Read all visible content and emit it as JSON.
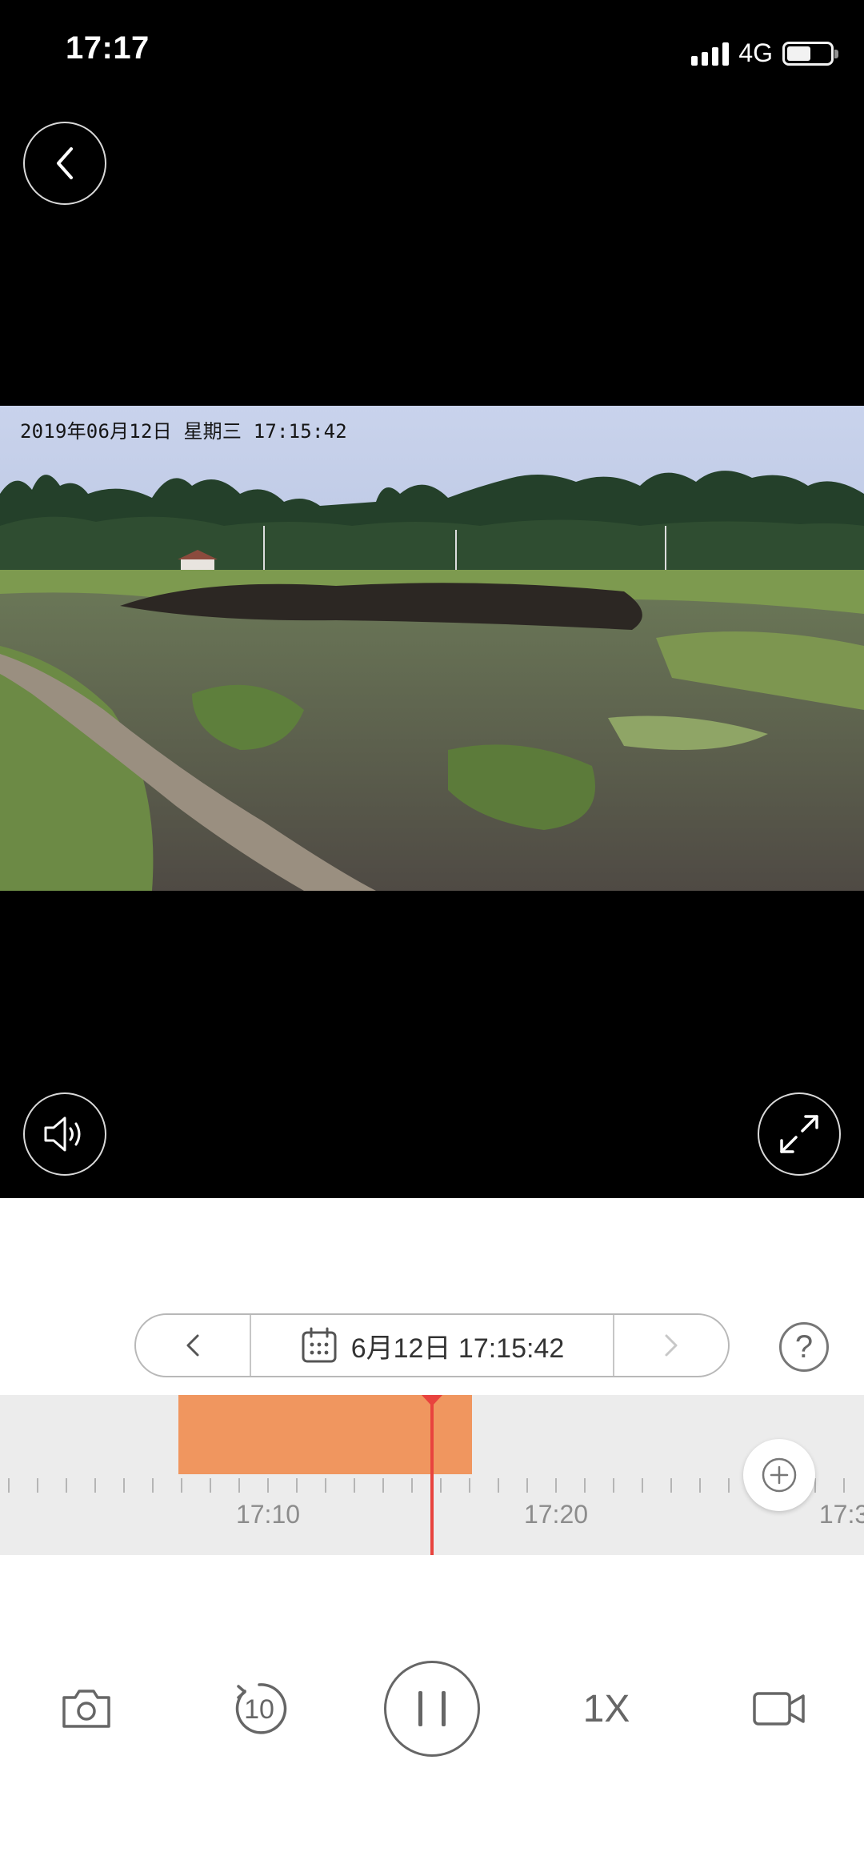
{
  "status_bar": {
    "time": "17:17",
    "network": "4G",
    "battery_level": 0.55
  },
  "player": {
    "back_icon": "chevron-left-icon",
    "osd_timestamp": "2019年06月12日  星期三  17:15:42",
    "sound_icon": "speaker-icon",
    "fullscreen_icon": "expand-icon"
  },
  "date_nav": {
    "prev_icon": "chevron-left-icon",
    "calendar_icon": "calendar-icon",
    "date_time": "6月12日 17:15:42",
    "next_icon": "chevron-right-icon",
    "next_enabled": false,
    "help_label": "?"
  },
  "timeline": {
    "tick_labels": [
      "17:10",
      "17:20",
      "17:3"
    ],
    "recording_start": "17:07",
    "recording_end": "17:17",
    "playhead_time": "17:15:42",
    "zoom_icon": "zoom-in-icon"
  },
  "controls": {
    "snapshot_icon": "camera-icon",
    "replay_label": "10",
    "replay_icon": "rewind-10-icon",
    "pause_icon": "pause-icon",
    "speed_label": "1X",
    "record_icon": "video-camera-icon"
  },
  "colors": {
    "recording_segment": "#f0965f",
    "playhead": "#e8433e",
    "timeline_bg": "#ececec"
  }
}
